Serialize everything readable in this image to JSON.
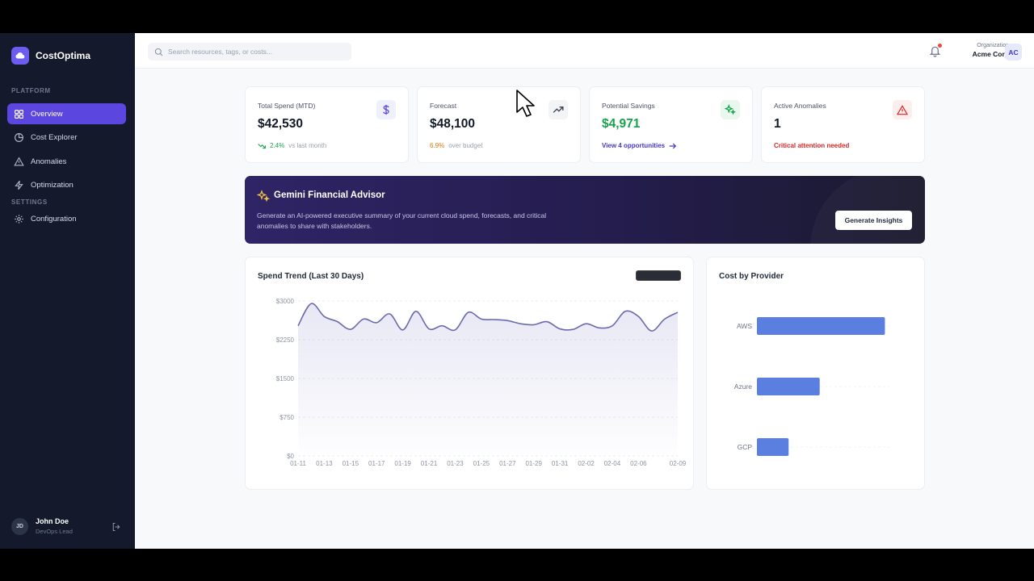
{
  "app": {
    "name": "CostOptima"
  },
  "sidebar": {
    "platform_label": "PLATFORM",
    "settings_label": "SETTINGS",
    "items": [
      {
        "label": "Overview",
        "icon": "grid-icon",
        "active": true
      },
      {
        "label": "Cost Explorer",
        "icon": "chart-pie-icon",
        "active": false
      },
      {
        "label": "Anomalies",
        "icon": "alert-triangle-icon",
        "active": false
      },
      {
        "label": "Optimization",
        "icon": "bolt-icon",
        "active": false
      }
    ],
    "settings_items": [
      {
        "label": "Configuration",
        "icon": "gear-icon"
      }
    ],
    "user": {
      "initials": "JD",
      "name": "John Doe",
      "role": "DevOps Lead"
    }
  },
  "topbar": {
    "search_placeholder": "Search resources, tags, or costs...",
    "org_label": "Organization",
    "org_name": "Acme Corp",
    "org_initials": "AC"
  },
  "kpis": [
    {
      "title": "Total Spend (MTD)",
      "value": "$42,530",
      "delta": "2.4%",
      "delta_text": "vs last month",
      "icon": "dollar-icon",
      "delta_color": "#16a34a"
    },
    {
      "title": "Forecast",
      "value": "$48,100",
      "delta": "6.9%",
      "delta_text": "over budget",
      "icon": "trending-up-icon",
      "delta_color": "#d97706"
    },
    {
      "title": "Potential Savings",
      "value": "$4,971",
      "link": "View 4 opportunities",
      "icon": "sparkles-icon",
      "value_color": "#16a34a"
    },
    {
      "title": "Active Anomalies",
      "value": "1",
      "alert": "Critical attention needed",
      "icon": "alert-triangle-icon",
      "alert_color": "#dc2626"
    }
  ],
  "gemini": {
    "title": "Gemini Financial Advisor",
    "description": "Generate an AI-powered executive summary of your current cloud spend, forecasts, and critical anomalies to share with stakeholders.",
    "button": "Generate Insights"
  },
  "spend_trend": {
    "title": "Spend Trend (Last 30 Days)"
  },
  "provider_chart": {
    "title": "Cost by Provider"
  },
  "chart_data": [
    {
      "type": "area",
      "title": "Spend Trend (Last 30 Days)",
      "y_ticks": [
        "$3000",
        "$2250",
        "$1500",
        "$750",
        "$0"
      ],
      "ylim": [
        0,
        3000
      ],
      "x_tick_labels": [
        "01-11",
        "01-13",
        "01-15",
        "01-17",
        "01-19",
        "01-21",
        "01-23",
        "01-25",
        "01-27",
        "01-29",
        "01-31",
        "02-02",
        "02-04",
        "02-06",
        "02-09"
      ],
      "x": [
        "01-11",
        "01-12",
        "01-13",
        "01-14",
        "01-15",
        "01-16",
        "01-17",
        "01-18",
        "01-19",
        "01-20",
        "01-21",
        "01-22",
        "01-23",
        "01-24",
        "01-25",
        "01-26",
        "01-27",
        "01-28",
        "01-29",
        "01-30",
        "01-31",
        "02-01",
        "02-02",
        "02-03",
        "02-04",
        "02-05",
        "02-06",
        "02-07",
        "02-08",
        "02-09"
      ],
      "values": [
        2520,
        2950,
        2700,
        2600,
        2450,
        2650,
        2580,
        2750,
        2440,
        2800,
        2460,
        2520,
        2440,
        2780,
        2650,
        2640,
        2620,
        2560,
        2540,
        2600,
        2460,
        2450,
        2560,
        2480,
        2520,
        2800,
        2700,
        2420,
        2650,
        2780
      ],
      "color": "#6b6ab0",
      "grid": true
    },
    {
      "type": "bar",
      "orientation": "horizontal",
      "title": "Cost by Provider",
      "categories": [
        "AWS",
        "Azure",
        "GCP"
      ],
      "values": [
        21000,
        10300,
        5200
      ],
      "color": "#5b7fe0",
      "grid": true
    }
  ]
}
